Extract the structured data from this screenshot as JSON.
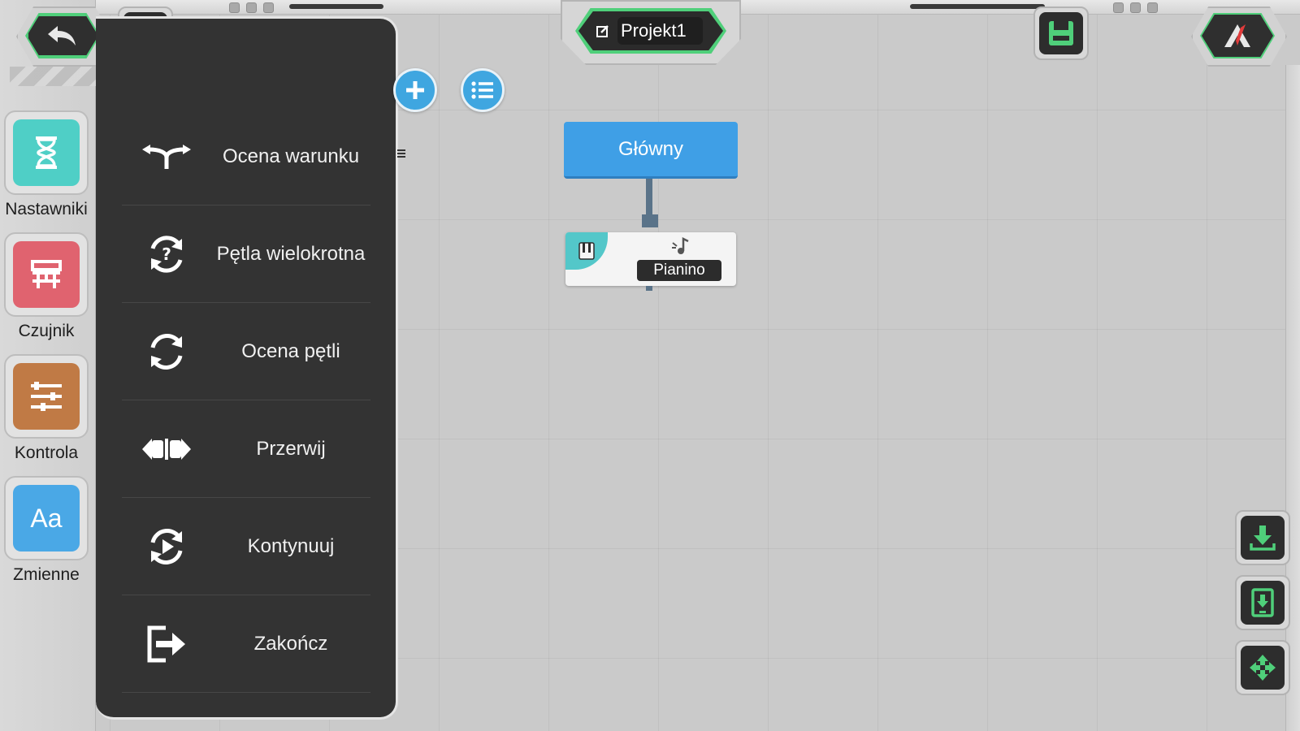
{
  "project": {
    "title": "Projekt1"
  },
  "categories": [
    {
      "id": "timers",
      "label": "Nastawniki",
      "icon": "hourglass-icon",
      "color": "#4fcfc6"
    },
    {
      "id": "sensor",
      "label": "Czujnik",
      "icon": "sensor-icon",
      "color": "#e0636f"
    },
    {
      "id": "control",
      "label": "Kontrola",
      "icon": "sliders-icon",
      "color": "#c07a45"
    },
    {
      "id": "variables",
      "label": "Zmienne",
      "icon": "text-aa-icon",
      "color": "#4aa8e6",
      "glyph": "Aa"
    }
  ],
  "palette": {
    "items": [
      {
        "label": "Ocena warunku",
        "icon": "branch-icon"
      },
      {
        "label": "Pętla wielokrotna",
        "icon": "loop-question-icon"
      },
      {
        "label": "Ocena pętli",
        "icon": "loop-icon"
      },
      {
        "label": "Przerwij",
        "icon": "break-icon"
      },
      {
        "label": "Kontynuuj",
        "icon": "continue-icon"
      },
      {
        "label": "Zakończ",
        "icon": "exit-icon"
      }
    ]
  },
  "program": {
    "main_block": "Główny",
    "sound_block": "Pianino"
  },
  "colors": {
    "accent_green": "#4fcf7a",
    "main_block_blue": "#3f9fe6",
    "panel_dark": "#333333",
    "canvas": "#cacaca"
  }
}
